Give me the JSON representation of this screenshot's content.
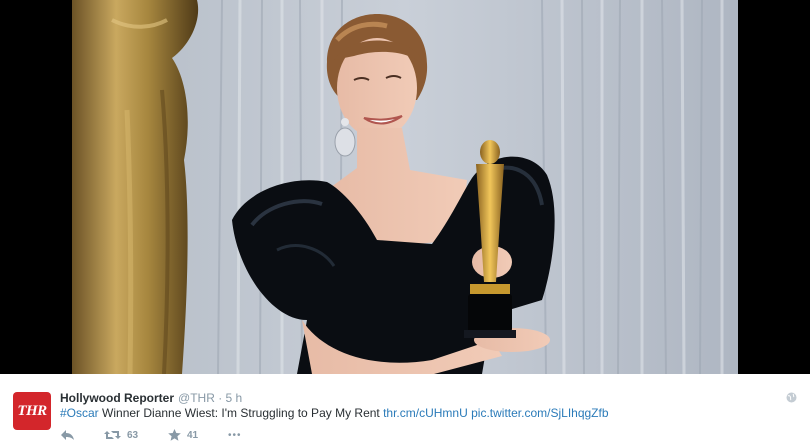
{
  "tweet": {
    "author_name": "Hollywood Reporter",
    "handle": "@THR",
    "separator": "·",
    "time": "5 h",
    "avatar_text": "THR",
    "text_hashtag": "#Oscar",
    "text_main": " Winner Dianne Wiest: I'm Struggling to Pay My Rent ",
    "link_1": "thr.cm/cUHmnU",
    "link_2": "pic.twitter.com/SjLIhqgZfb",
    "retweets": "63",
    "favorites": "41",
    "more": "•••"
  },
  "icons": {
    "reply": "reply-icon",
    "retweet": "retweet-icon",
    "favorite": "star-icon",
    "more": "more-icon",
    "globe": "globe-icon"
  },
  "colors": {
    "link": "#2b7bb9",
    "avatar_bg": "#d3262b",
    "muted": "#8899a6"
  }
}
